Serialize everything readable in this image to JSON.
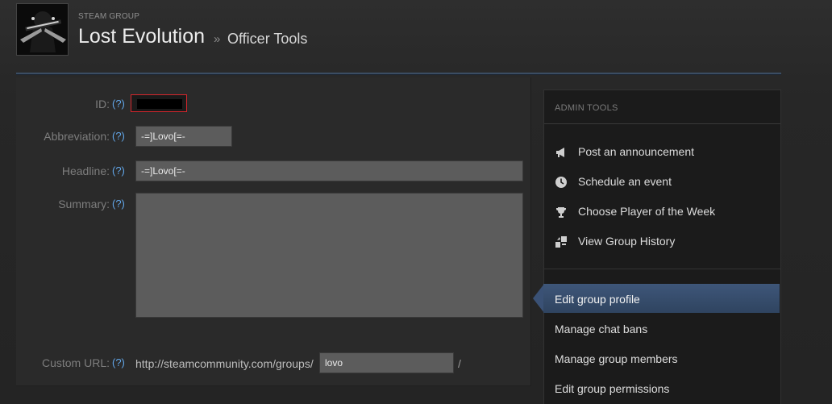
{
  "header": {
    "kicker": "STEAM GROUP",
    "group_name": "Lost Evolution",
    "separator": "»",
    "section": "Officer Tools"
  },
  "form": {
    "id": {
      "label": "ID:",
      "help": "(?)"
    },
    "abbreviation": {
      "label": "Abbreviation:",
      "help": "(?)",
      "value": "-=]Lovo[=-"
    },
    "headline": {
      "label": "Headline:",
      "help": "(?)",
      "value": "-=]Lovo[=-"
    },
    "summary": {
      "label": "Summary:",
      "help": "(?)",
      "value": ""
    },
    "custom_url": {
      "label": "Custom URL:",
      "help": "(?)",
      "prefix": "http://steamcommunity.com/groups/",
      "value": "lovo",
      "suffix": "/"
    }
  },
  "admin_tools": {
    "title": "ADMIN TOOLS",
    "items": [
      {
        "label": "Post an announcement",
        "icon": "megaphone-icon"
      },
      {
        "label": "Schedule an event",
        "icon": "clock-icon"
      },
      {
        "label": "Choose Player of the Week",
        "icon": "trophy-icon"
      },
      {
        "label": "View Group History",
        "icon": "history-icon"
      }
    ]
  },
  "nav": {
    "items": [
      {
        "label": "Edit group profile",
        "active": true
      },
      {
        "label": "Manage chat bans",
        "active": false
      },
      {
        "label": "Manage group members",
        "active": false
      },
      {
        "label": "Edit group permissions",
        "active": false
      }
    ]
  },
  "colors": {
    "accent_blue": "#3e5679",
    "help_link": "#62a6e8",
    "id_highlight": "#d4262c"
  }
}
